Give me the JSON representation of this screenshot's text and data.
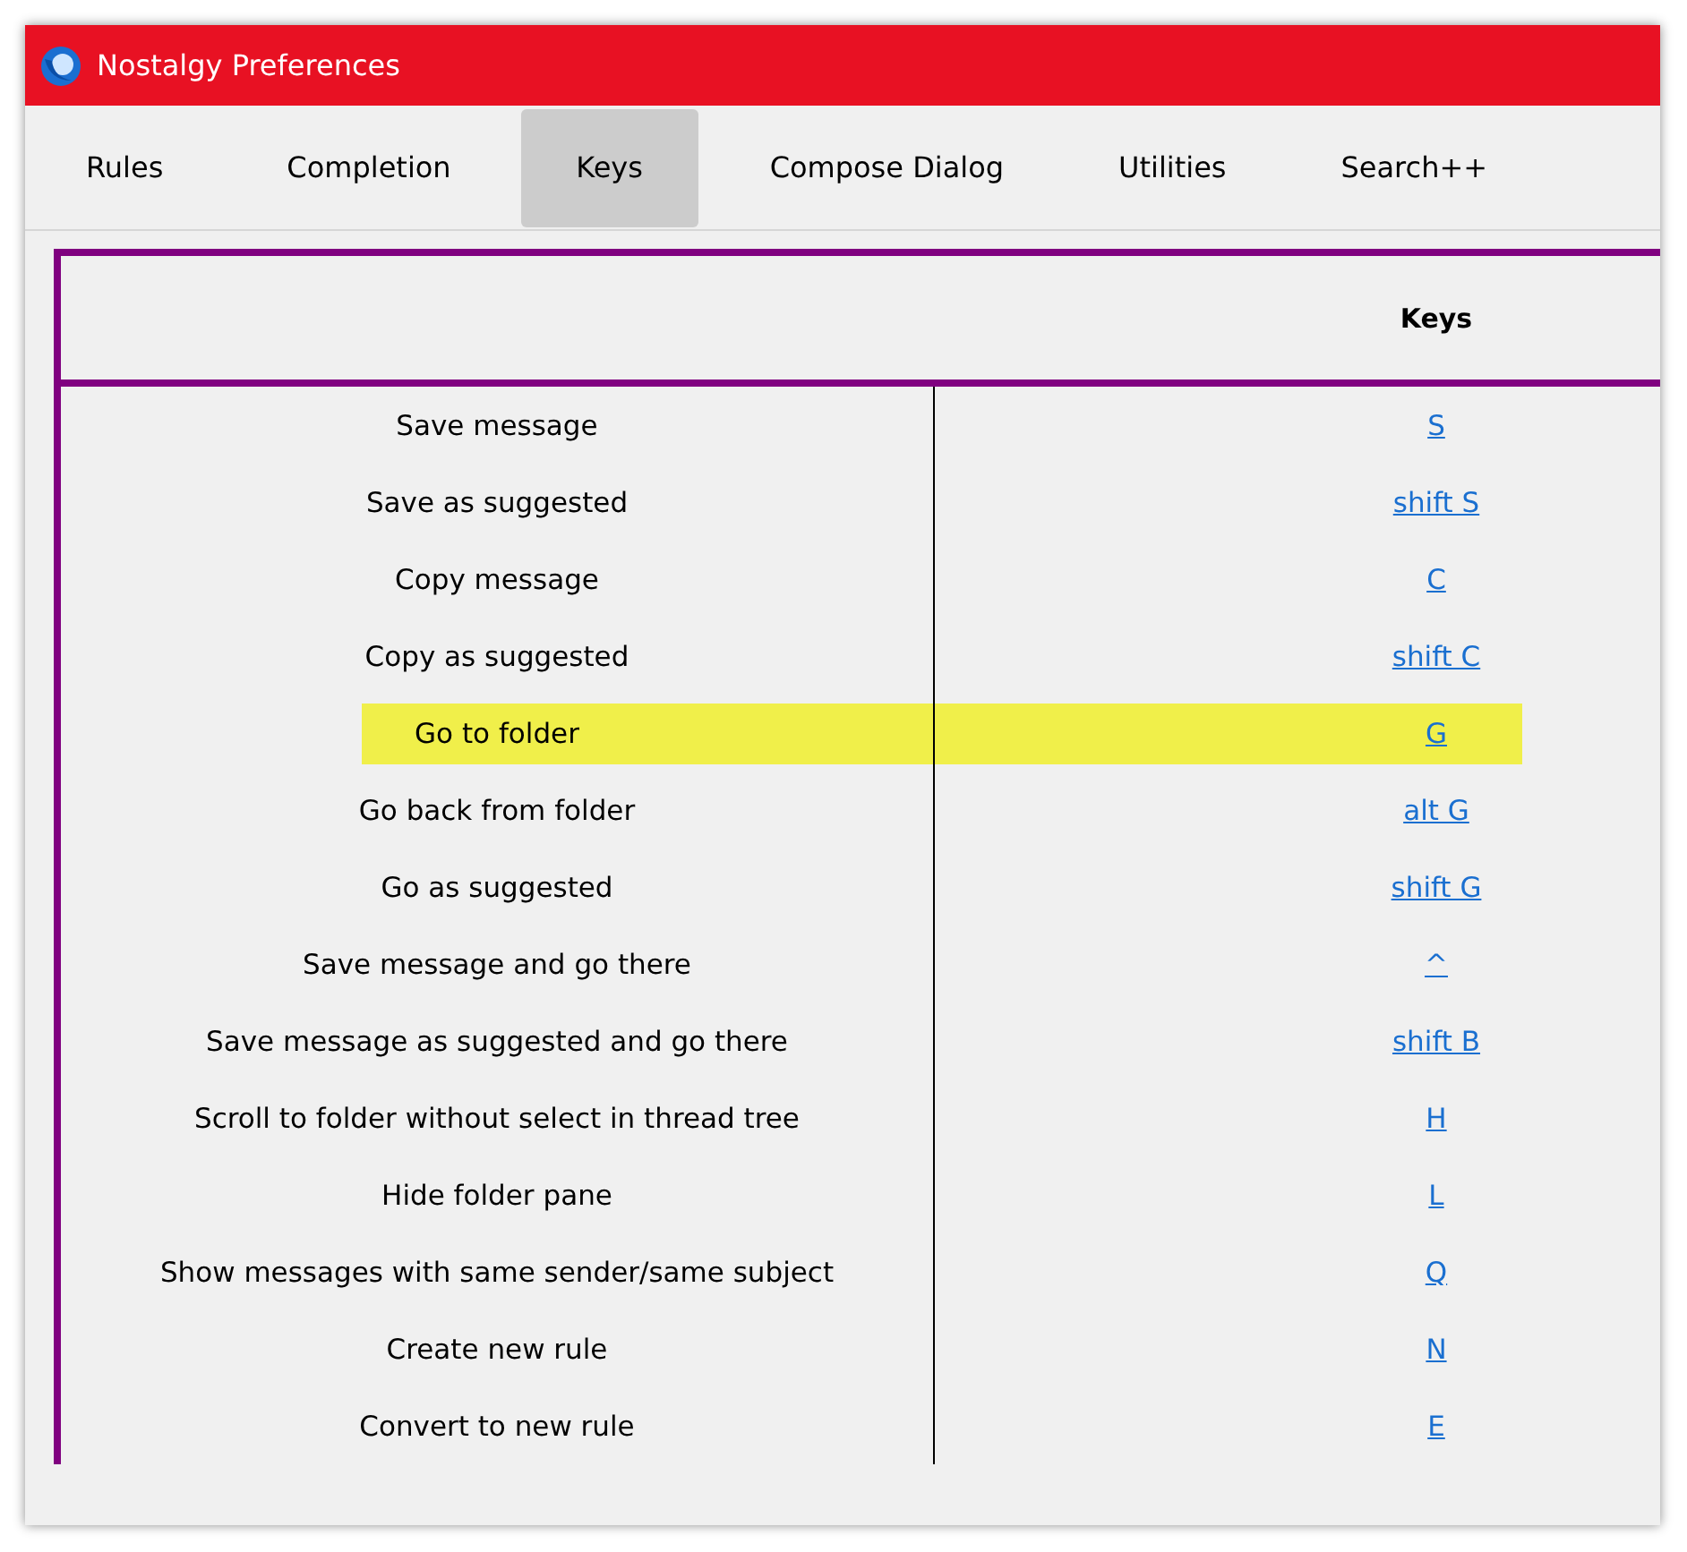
{
  "window": {
    "title": "Nostalgy Preferences"
  },
  "tabs": [
    {
      "label": "Rules",
      "selected": false
    },
    {
      "label": "Completion",
      "selected": false
    },
    {
      "label": "Keys",
      "selected": true
    },
    {
      "label": "Compose Dialog",
      "selected": false
    },
    {
      "label": "Utilities",
      "selected": false
    },
    {
      "label": "Search++",
      "selected": false
    }
  ],
  "table": {
    "columns": [
      "Keys"
    ],
    "rows": [
      {
        "action": "Save message",
        "key": "S",
        "highlighted": false
      },
      {
        "action": "Save as suggested",
        "key": "shift S",
        "highlighted": false
      },
      {
        "action": "Copy message",
        "key": "C",
        "highlighted": false
      },
      {
        "action": "Copy as suggested",
        "key": "shift C",
        "highlighted": false
      },
      {
        "action": "Go to folder",
        "key": "G",
        "highlighted": true
      },
      {
        "action": "Go back from folder",
        "key": "alt G",
        "highlighted": false
      },
      {
        "action": "Go as suggested",
        "key": "shift G",
        "highlighted": false
      },
      {
        "action": "Save message and go there",
        "key": "^",
        "highlighted": false
      },
      {
        "action": "Save message as suggested and go there",
        "key": "shift B",
        "highlighted": false
      },
      {
        "action": "Scroll to folder without select in thread tree",
        "key": "H",
        "highlighted": false
      },
      {
        "action": "Hide folder pane",
        "key": "L",
        "highlighted": false
      },
      {
        "action": "Show messages with same sender/same subject",
        "key": "Q",
        "highlighted": false
      },
      {
        "action": "Create new rule",
        "key": "N",
        "highlighted": false
      },
      {
        "action": "Convert to new rule",
        "key": "E",
        "highlighted": false
      }
    ]
  }
}
